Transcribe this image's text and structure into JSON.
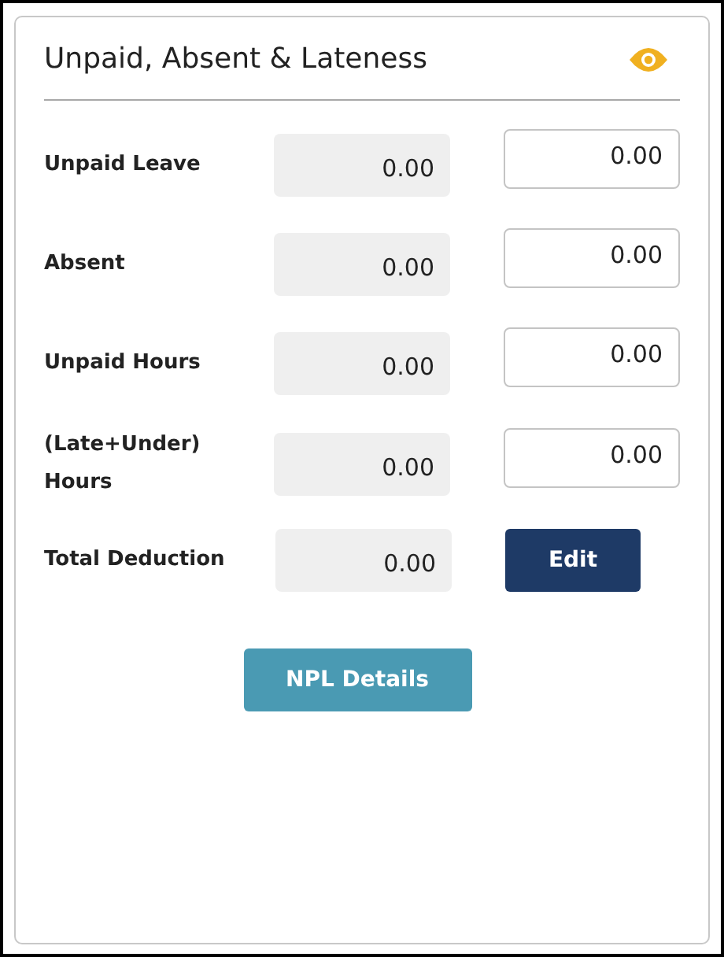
{
  "panel": {
    "title": "Unpaid, Absent & Lateness"
  },
  "rows": [
    {
      "kind": "field",
      "label": "Unpaid Leave",
      "value": "0.00",
      "input": "0.00"
    },
    {
      "kind": "field",
      "label": "Absent",
      "value": "0.00",
      "input": "0.00"
    },
    {
      "kind": "field",
      "label": "Unpaid Hours",
      "value": "0.00",
      "input": "0.00"
    },
    {
      "kind": "field",
      "label": "(Late+Under) Hours",
      "value": "0.00",
      "input": "0.00"
    },
    {
      "kind": "total",
      "label": "Total Deduction",
      "value": "0.00",
      "button": "Edit"
    }
  ],
  "footer_button": "NPL Details"
}
